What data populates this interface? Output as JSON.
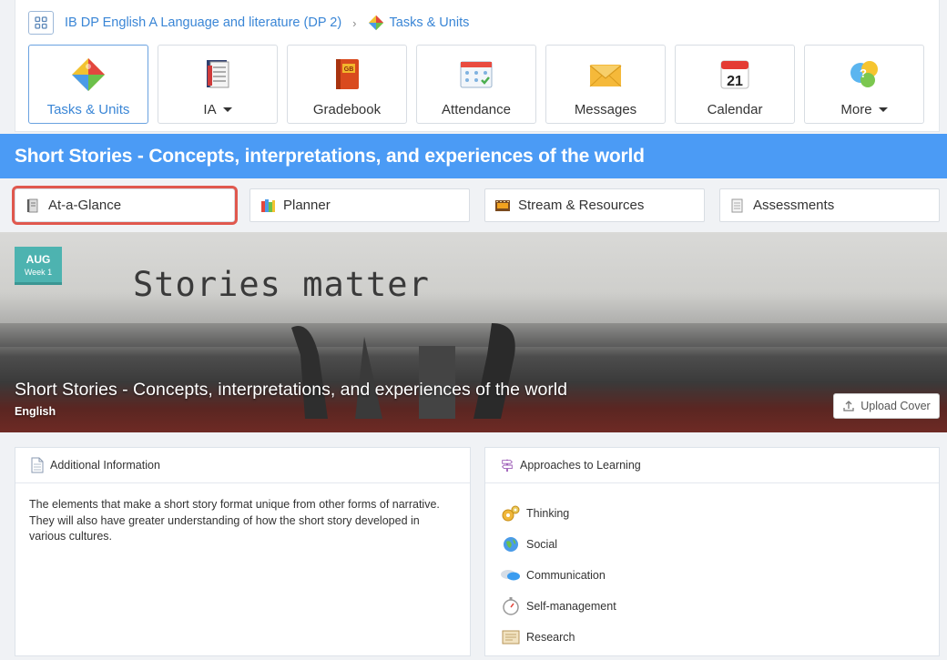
{
  "breadcrumb": {
    "course": "IB DP English A Language and literature (DP 2)",
    "separator": "›",
    "current": "Tasks & Units"
  },
  "nav_tiles": [
    {
      "label": "Tasks & Units",
      "icon": "puzzle-icon",
      "active": true,
      "dropdown": false
    },
    {
      "label": "IA",
      "icon": "notebook-icon",
      "active": false,
      "dropdown": true
    },
    {
      "label": "Gradebook",
      "icon": "gradebook-icon",
      "active": false,
      "dropdown": false
    },
    {
      "label": "Attendance",
      "icon": "attendance-icon",
      "active": false,
      "dropdown": false
    },
    {
      "label": "Messages",
      "icon": "envelope-icon",
      "active": false,
      "dropdown": false
    },
    {
      "label": "Calendar",
      "icon": "calendar-icon",
      "active": false,
      "dropdown": false
    },
    {
      "label": "More",
      "icon": "lightbulb-icon",
      "active": false,
      "dropdown": true
    }
  ],
  "gradebook_badge": "GB",
  "calendar_day": "21",
  "unit_title": "Short Stories - Concepts, interpretations, and experiences of the world",
  "sub_tabs": [
    {
      "label": "At-a-Glance",
      "icon": "book-icon",
      "selected": true
    },
    {
      "label": "Planner",
      "icon": "books-icon",
      "selected": false
    },
    {
      "label": "Stream & Resources",
      "icon": "film-icon",
      "selected": false
    },
    {
      "label": "Assessments",
      "icon": "papers-icon",
      "selected": false
    }
  ],
  "cover": {
    "month": "AUG",
    "week": "Week 1",
    "image_text": "Stories matter",
    "title": "Short Stories - Concepts, interpretations, and experiences of the world",
    "subject": "English",
    "upload_label": "Upload Cover"
  },
  "additional_info": {
    "heading": "Additional Information",
    "text": "The elements that make a short story format unique from other forms of narrative. They will also have greater understanding of how the short story developed in various cultures."
  },
  "atl": {
    "heading": "Approaches to Learning",
    "items": [
      {
        "label": "Thinking",
        "icon": "gears-icon"
      },
      {
        "label": "Social",
        "icon": "globe-icon"
      },
      {
        "label": "Communication",
        "icon": "speech-bubbles-icon"
      },
      {
        "label": "Self-management",
        "icon": "stopwatch-icon"
      },
      {
        "label": "Research",
        "icon": "scroll-icon"
      }
    ]
  },
  "colors": {
    "accent_blue": "#4b9bf5",
    "link_blue": "#3a86d6",
    "selection_red": "#e0584e",
    "badge_teal": "#4db3b0"
  }
}
